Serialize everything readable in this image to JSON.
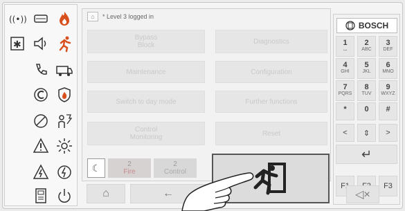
{
  "status": {
    "home_icon": "home-small-icon",
    "text": "* Level 3 logged in"
  },
  "menu": {
    "bypass_block": "Bypass\nBlock",
    "diagnostics": "Diagnostics",
    "maintenance": "Maintenance",
    "configuration": "Configuration",
    "day_mode": "Switch to day mode",
    "further_functions": "Further functions",
    "control_monitoring": "Control\nMonitoring",
    "reset": "Reset"
  },
  "tabs": {
    "fire": {
      "count": "2",
      "label": "Fire"
    },
    "control": {
      "count": "2",
      "label": "Control"
    }
  },
  "nav": {
    "home": "⌂",
    "back": "←",
    "mute": "◁×"
  },
  "keypad": {
    "brand": "BOSCH",
    "keys": [
      {
        "n": "1",
        "l": "⌴"
      },
      {
        "n": "2",
        "l": "ABC"
      },
      {
        "n": "3",
        "l": "DEF"
      },
      {
        "n": "4",
        "l": "GHI"
      },
      {
        "n": "5",
        "l": "JKL"
      },
      {
        "n": "6",
        "l": "MNO"
      },
      {
        "n": "7",
        "l": "PQRS"
      },
      {
        "n": "8",
        "l": "TUV"
      },
      {
        "n": "9",
        "l": "WXYZ"
      },
      {
        "n": "*",
        "l": ""
      },
      {
        "n": "0",
        "l": ""
      },
      {
        "n": "#",
        "l": ""
      }
    ],
    "left": "<",
    "updown": "⇕",
    "right": ">",
    "enter": "↵",
    "f1": "F1",
    "f2": "F2",
    "f3": "F3"
  },
  "colors": {
    "fire_tab": "#d6d2d2",
    "exit_border": "#555555"
  }
}
